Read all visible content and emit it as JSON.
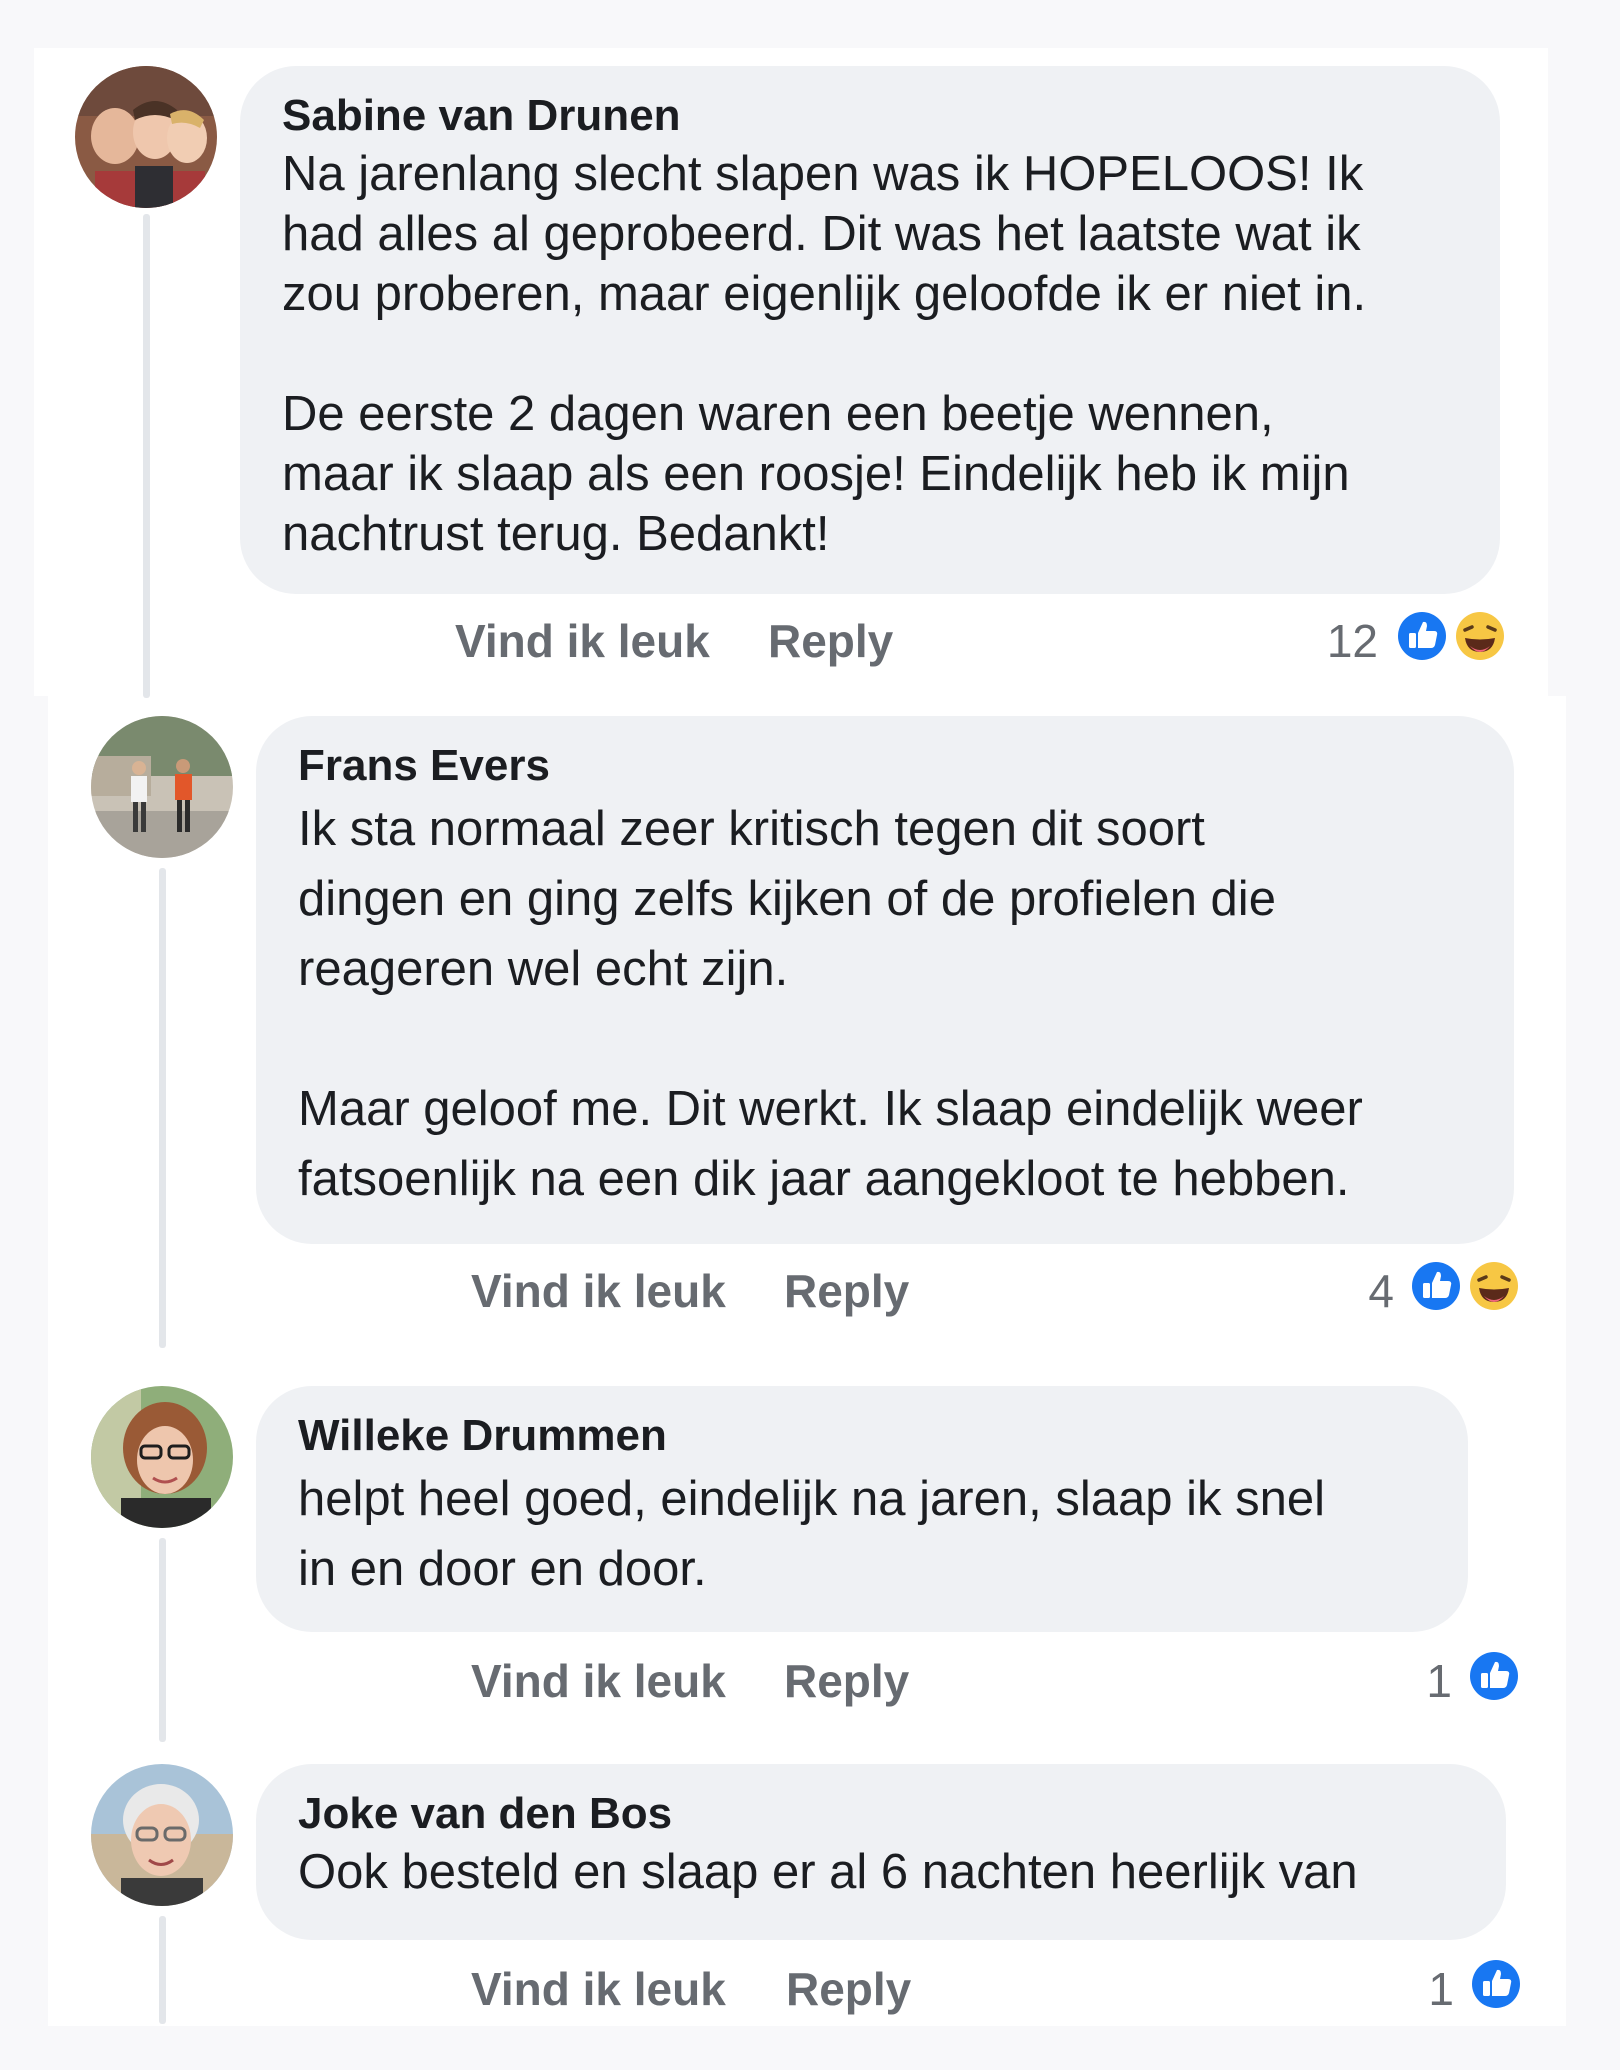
{
  "comments": [
    {
      "author": "Sabine van Drunen",
      "text": "Na jarenlang slecht slapen was ik HOPELOOS! Ik\nhad alles al geprobeerd. Dit was het laatste wat ik\nzou proberen, maar eigenlijk geloofde ik er niet in.\n\nDe eerste 2 dagen waren een beetje wennen,\nmaar ik slaap als een roosje! Eindelijk heb ik mijn\nnachtrust terug. Bedankt!",
      "like_label": "Vind ik leuk",
      "reply_label": "Reply",
      "reaction_count": "12",
      "reactions": [
        "like-icon",
        "haha-icon"
      ]
    },
    {
      "author": "Frans Evers",
      "text": "Ik sta normaal zeer kritisch tegen dit soort\ndingen en ging zelfs kijken of de profielen die\nreageren wel echt zijn.\n\nMaar geloof me. Dit werkt. Ik slaap eindelijk weer\nfatsoenlijk na een dik jaar aangekloot te hebben.",
      "like_label": "Vind ik leuk",
      "reply_label": "Reply",
      "reaction_count": "4",
      "reactions": [
        "like-icon",
        "haha-icon"
      ]
    },
    {
      "author": "Willeke Drummen",
      "text": "helpt heel goed, eindelijk na jaren, slaap ik snel\nin en door en door.",
      "like_label": "Vind ik leuk",
      "reply_label": "Reply",
      "reaction_count": "1",
      "reactions": [
        "like-icon"
      ]
    },
    {
      "author": "Joke van den Bos",
      "text": "Ook besteld en slaap er al 6 nachten heerlijk van",
      "like_label": "Vind ik leuk",
      "reply_label": "Reply",
      "reaction_count": "1",
      "reactions": [
        "like-icon"
      ]
    }
  ],
  "colors": {
    "bubble": "#eff1f4",
    "like_blue": "#1877f2",
    "haha_yellow": "#f7c744",
    "action_text": "#676b71"
  }
}
